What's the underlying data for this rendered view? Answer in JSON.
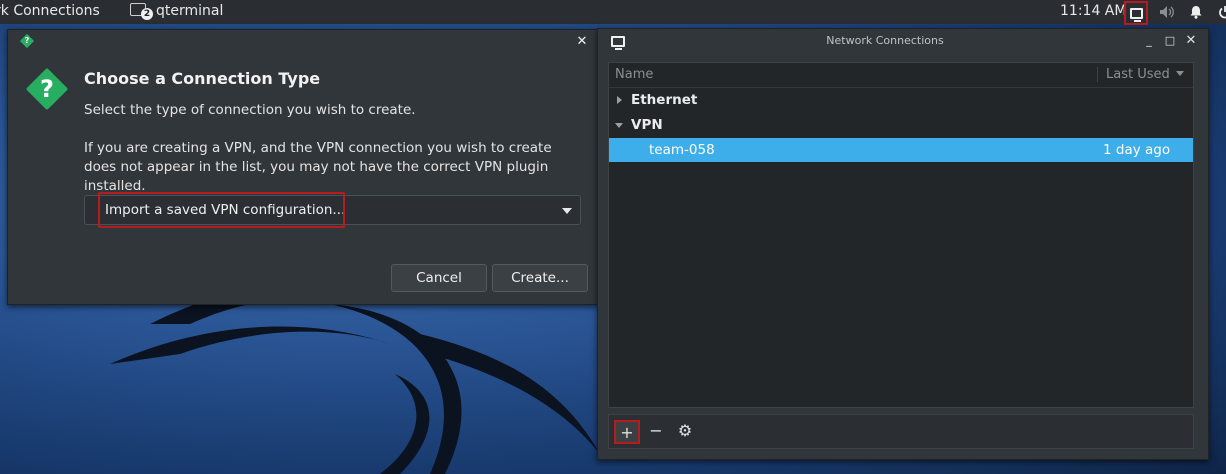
{
  "panel": {
    "task_network": "rk Connections",
    "task_terminal": "qterminal",
    "terminal_badge": "2",
    "clock": "11:14 AM",
    "tray_icons": [
      "network-icon",
      "volume-icon",
      "bell-icon",
      "power-icon"
    ]
  },
  "dialog": {
    "title_icon": "question-icon",
    "heading": "Choose a Connection Type",
    "subtitle": "Select the type of connection you wish to create.",
    "info": "If you are creating a VPN, and the VPN connection you wish to create does not appear in the list, you may not have the correct VPN plugin installed.",
    "connection_type": "Import a saved VPN configuration...",
    "cancel_label": "Cancel",
    "create_label": "Create...",
    "close_glyph": "✕"
  },
  "nc": {
    "title": "Network Connections",
    "columns": {
      "name": "Name",
      "last_used": "Last Used"
    },
    "groups": [
      {
        "label": "Ethernet",
        "expanded": false
      },
      {
        "label": "VPN",
        "expanded": true
      }
    ],
    "connections": [
      {
        "name": "team-058",
        "last_used": "1 day ago",
        "selected": true
      }
    ],
    "toolbar": {
      "add": "+",
      "remove": "−",
      "settings": "⚙"
    },
    "wm": {
      "minimize": "_",
      "maximize": "□",
      "close": "✕"
    }
  },
  "colors": {
    "accent": "#3daee9",
    "highlight_box": "#b71c1c",
    "question_green": "#27ae60"
  }
}
